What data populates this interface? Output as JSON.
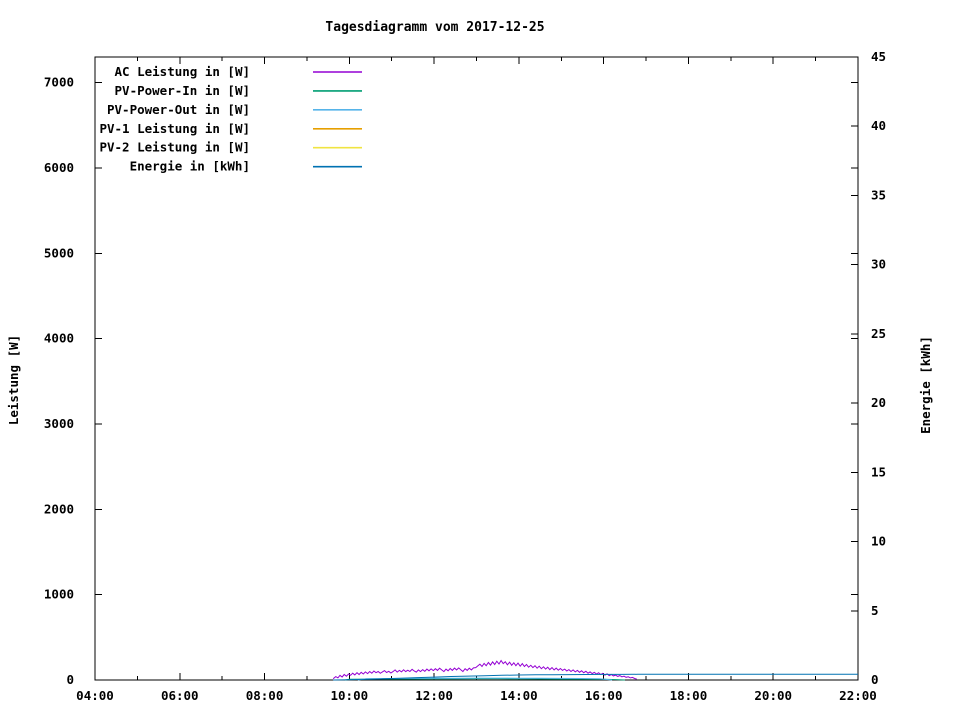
{
  "chart_data": {
    "type": "line",
    "title": "Tagesdiagramm vom 2017-12-25",
    "ylabel_left": "Leistung [W]",
    "ylabel_right": "Energie [kWh]",
    "background_color": "#ffffff",
    "axis_color": "#000000",
    "grid": false,
    "legend_position": "top-left-inside",
    "x_axis": {
      "min": 4,
      "max": 22,
      "minor_step_hours": 1,
      "major_hours": [
        4,
        6,
        8,
        10,
        12,
        14,
        16,
        18,
        20,
        22
      ],
      "major_labels": [
        "04:00",
        "06:00",
        "08:00",
        "10:00",
        "12:00",
        "14:00",
        "16:00",
        "18:00",
        "20:00",
        "22:00"
      ]
    },
    "y_left": {
      "min": 0,
      "max": 7300,
      "ticks": [
        0,
        1000,
        2000,
        3000,
        4000,
        5000,
        6000,
        7000
      ]
    },
    "y_right": {
      "min": 0,
      "max": 45,
      "ticks": [
        0,
        5,
        10,
        15,
        20,
        25,
        30,
        35,
        40,
        45
      ]
    },
    "series": [
      {
        "name": "AC Leistung in [W]",
        "color": "#9400D3",
        "axis": "left",
        "points": [
          [
            9.62,
            15
          ],
          [
            9.68,
            40
          ],
          [
            9.73,
            25
          ],
          [
            9.78,
            55
          ],
          [
            9.83,
            35
          ],
          [
            9.88,
            65
          ],
          [
            9.93,
            45
          ],
          [
            9.98,
            70
          ],
          [
            10.03,
            55
          ],
          [
            10.08,
            80
          ],
          [
            10.13,
            60
          ],
          [
            10.18,
            85
          ],
          [
            10.23,
            65
          ],
          [
            10.28,
            90
          ],
          [
            10.33,
            70
          ],
          [
            10.38,
            95
          ],
          [
            10.43,
            75
          ],
          [
            10.48,
            100
          ],
          [
            10.53,
            80
          ],
          [
            10.58,
            105
          ],
          [
            10.63,
            85
          ],
          [
            10.68,
            100
          ],
          [
            10.73,
            78
          ],
          [
            10.78,
            95
          ],
          [
            10.83,
            110
          ],
          [
            10.88,
            88
          ],
          [
            10.93,
            102
          ],
          [
            10.98,
            82
          ],
          [
            11.03,
            98
          ],
          [
            11.08,
            118
          ],
          [
            11.13,
            92
          ],
          [
            11.18,
            112
          ],
          [
            11.23,
            95
          ],
          [
            11.28,
            120
          ],
          [
            11.33,
            98
          ],
          [
            11.38,
            115
          ],
          [
            11.43,
            100
          ],
          [
            11.48,
            125
          ],
          [
            11.53,
            105
          ],
          [
            11.58,
            92
          ],
          [
            11.63,
            118
          ],
          [
            11.68,
            98
          ],
          [
            11.73,
            122
          ],
          [
            11.78,
            102
          ],
          [
            11.83,
            128
          ],
          [
            11.88,
            108
          ],
          [
            11.93,
            130
          ],
          [
            11.98,
            110
          ],
          [
            12.03,
            132
          ],
          [
            12.08,
            112
          ],
          [
            12.13,
            138
          ],
          [
            12.18,
            118
          ],
          [
            12.23,
            98
          ],
          [
            12.28,
            128
          ],
          [
            12.33,
            108
          ],
          [
            12.38,
            135
          ],
          [
            12.43,
            112
          ],
          [
            12.48,
            140
          ],
          [
            12.53,
            118
          ],
          [
            12.58,
            142
          ],
          [
            12.63,
            120
          ],
          [
            12.68,
            100
          ],
          [
            12.73,
            132
          ],
          [
            12.78,
            112
          ],
          [
            12.83,
            138
          ],
          [
            12.88,
            118
          ],
          [
            12.93,
            142
          ],
          [
            12.98,
            145
          ],
          [
            13.03,
            165
          ],
          [
            13.08,
            185
          ],
          [
            13.13,
            158
          ],
          [
            13.18,
            195
          ],
          [
            13.23,
            168
          ],
          [
            13.28,
            205
          ],
          [
            13.33,
            175
          ],
          [
            13.38,
            212
          ],
          [
            13.43,
            182
          ],
          [
            13.48,
            220
          ],
          [
            13.53,
            188
          ],
          [
            13.58,
            228
          ],
          [
            13.63,
            192
          ],
          [
            13.68,
            215
          ],
          [
            13.73,
            178
          ],
          [
            13.78,
            208
          ],
          [
            13.83,
            172
          ],
          [
            13.88,
            202
          ],
          [
            13.93,
            168
          ],
          [
            13.98,
            198
          ],
          [
            14.03,
            162
          ],
          [
            14.08,
            192
          ],
          [
            14.13,
            158
          ],
          [
            14.18,
            182
          ],
          [
            14.23,
            150
          ],
          [
            14.28,
            172
          ],
          [
            14.33,
            145
          ],
          [
            14.38,
            168
          ],
          [
            14.43,
            138
          ],
          [
            14.48,
            162
          ],
          [
            14.53,
            132
          ],
          [
            14.58,
            155
          ],
          [
            14.63,
            128
          ],
          [
            14.68,
            150
          ],
          [
            14.73,
            122
          ],
          [
            14.78,
            145
          ],
          [
            14.83,
            118
          ],
          [
            14.88,
            140
          ],
          [
            14.93,
            115
          ],
          [
            14.98,
            135
          ],
          [
            15.03,
            112
          ],
          [
            15.08,
            128
          ],
          [
            15.13,
            105
          ],
          [
            15.18,
            122
          ],
          [
            15.23,
            100
          ],
          [
            15.28,
            118
          ],
          [
            15.33,
            95
          ],
          [
            15.38,
            112
          ],
          [
            15.43,
            90
          ],
          [
            15.48,
            108
          ],
          [
            15.53,
            85
          ],
          [
            15.58,
            102
          ],
          [
            15.63,
            80
          ],
          [
            15.68,
            95
          ],
          [
            15.73,
            75
          ],
          [
            15.78,
            90
          ],
          [
            15.83,
            70
          ],
          [
            15.88,
            85
          ],
          [
            15.93,
            65
          ],
          [
            15.98,
            78
          ],
          [
            16.03,
            58
          ],
          [
            16.08,
            72
          ],
          [
            16.13,
            52
          ],
          [
            16.18,
            65
          ],
          [
            16.23,
            48
          ],
          [
            16.28,
            58
          ],
          [
            16.33,
            42
          ],
          [
            16.38,
            52
          ],
          [
            16.43,
            38
          ],
          [
            16.48,
            45
          ],
          [
            16.53,
            32
          ],
          [
            16.58,
            38
          ],
          [
            16.63,
            25
          ],
          [
            16.68,
            30
          ],
          [
            16.73,
            18
          ],
          [
            16.78,
            12
          ]
        ]
      },
      {
        "name": "PV-Power-In in [W]",
        "color": "#009E73",
        "axis": "left",
        "points": [
          [
            9.9,
            0
          ],
          [
            10.0,
            8
          ],
          [
            10.5,
            10
          ],
          [
            11.0,
            12
          ],
          [
            11.5,
            12
          ],
          [
            12.0,
            13
          ],
          [
            12.5,
            13
          ],
          [
            13.0,
            14
          ],
          [
            13.5,
            14
          ],
          [
            14.0,
            13
          ],
          [
            14.5,
            12
          ],
          [
            15.0,
            11
          ],
          [
            15.5,
            10
          ],
          [
            16.0,
            8
          ],
          [
            16.3,
            5
          ],
          [
            16.5,
            0
          ]
        ]
      },
      {
        "name": "PV-Power-Out in [W]",
        "color": "#56B4E9",
        "axis": "left",
        "points": [
          [
            10.2,
            0
          ],
          [
            10.4,
            15
          ],
          [
            11.0,
            18
          ],
          [
            11.5,
            19
          ],
          [
            12.0,
            20
          ],
          [
            12.5,
            21
          ],
          [
            13.0,
            22
          ],
          [
            13.5,
            22
          ],
          [
            14.0,
            21
          ],
          [
            14.5,
            20
          ],
          [
            15.0,
            19
          ],
          [
            15.5,
            17
          ],
          [
            15.9,
            14
          ],
          [
            16.2,
            0
          ]
        ]
      },
      {
        "name": "PV-1 Leistung in [W]",
        "color": "#E69F00",
        "axis": "left",
        "points": []
      },
      {
        "name": "PV-2 Leistung in [W]",
        "color": "#F0E442",
        "axis": "left",
        "points": []
      },
      {
        "name": "Energie in [kWh]",
        "color": "#0072B2",
        "axis": "right",
        "points": [
          [
            9.62,
            0
          ],
          [
            10.0,
            0.02
          ],
          [
            10.4,
            0.05
          ],
          [
            10.8,
            0.09
          ],
          [
            11.2,
            0.13
          ],
          [
            11.6,
            0.17
          ],
          [
            12.0,
            0.21
          ],
          [
            12.4,
            0.25
          ],
          [
            12.8,
            0.28
          ],
          [
            13.2,
            0.31
          ],
          [
            13.6,
            0.34
          ],
          [
            14.0,
            0.36
          ],
          [
            14.4,
            0.375
          ],
          [
            14.8,
            0.385
          ],
          [
            15.2,
            0.393
          ],
          [
            15.6,
            0.399
          ],
          [
            16.0,
            0.404
          ],
          [
            16.4,
            0.408
          ],
          [
            16.8,
            0.41
          ],
          [
            22.0,
            0.41
          ]
        ]
      }
    ]
  }
}
